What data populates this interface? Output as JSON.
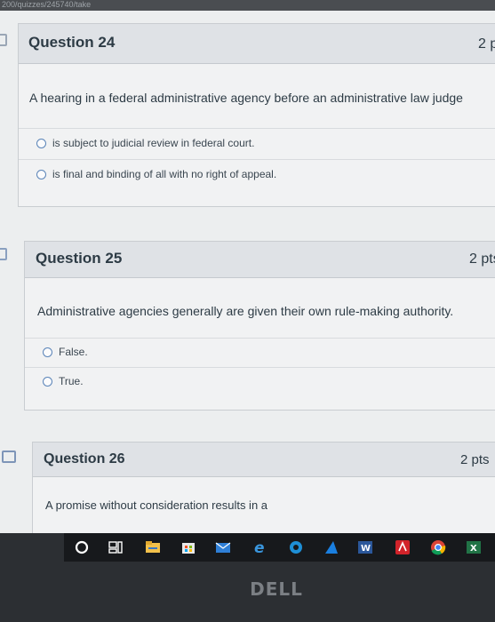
{
  "browser": {
    "url_fragment": "200/quizzes/245740/take"
  },
  "questions": [
    {
      "title": "Question 24",
      "points": "2 p",
      "text": "A hearing in a federal administrative agency before an administrative law judge",
      "answers": [
        "is subject to judicial review in federal court.",
        "is final and binding of all with no right of appeal."
      ]
    },
    {
      "title": "Question 25",
      "points": "2 pts",
      "text": "Administrative agencies generally are given their own rule-making authority.",
      "answers": [
        "False.",
        "True."
      ]
    },
    {
      "title": "Question 26",
      "points": "2 pts",
      "text": "A promise without consideration results in a"
    }
  ],
  "taskbar": {
    "icons": [
      "cortana-icon",
      "task-view-icon",
      "file-explorer-icon",
      "store-icon",
      "mail-icon",
      "edge-icon",
      "ie-icon",
      "azure-icon",
      "word-icon",
      "acrobat-icon",
      "chrome-icon",
      "excel-icon"
    ]
  },
  "bezel": {
    "brand": "DELL"
  },
  "colors": {
    "page_bg": "#eceeef",
    "header_bg": "#dfe2e6",
    "radio_border": "#5a84b8",
    "text": "#2d3b45"
  }
}
